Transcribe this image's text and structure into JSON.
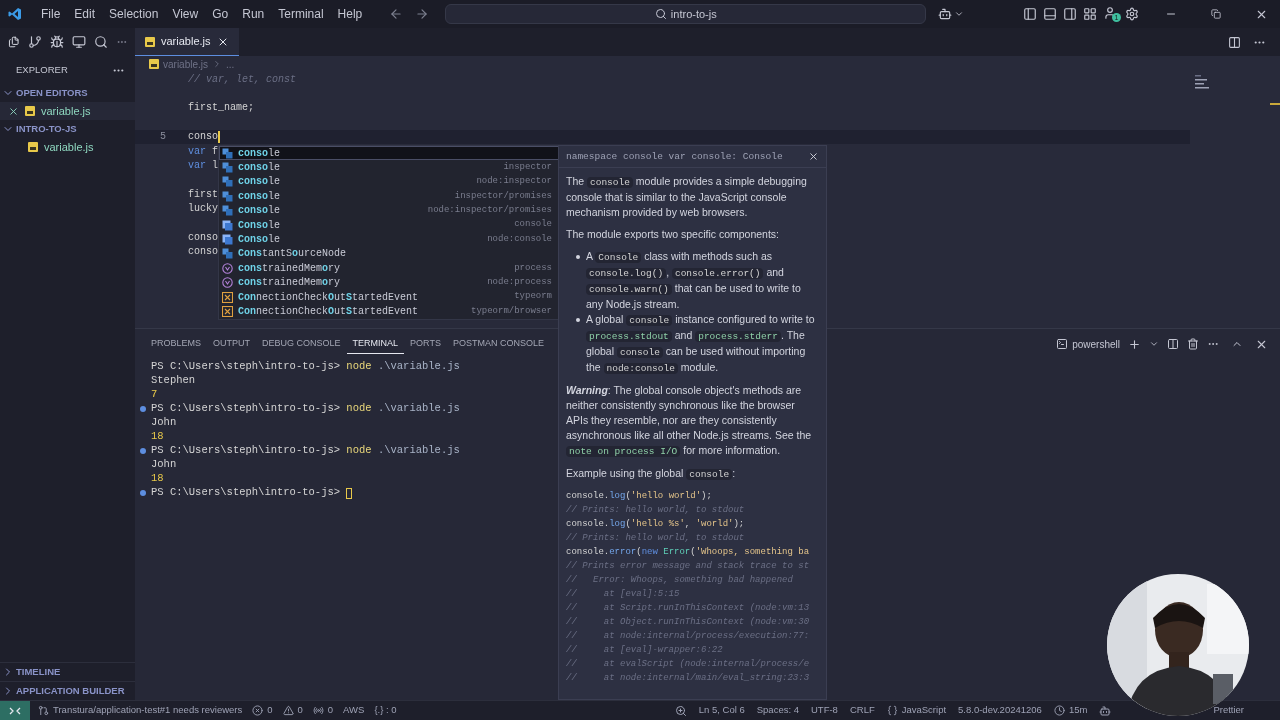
{
  "title_bar": {
    "menu": [
      "File",
      "Edit",
      "Selection",
      "View",
      "Go",
      "Run",
      "Terminal",
      "Help"
    ],
    "search": "intro-to-js",
    "account_badge": "1"
  },
  "sidebar": {
    "header": "EXPLORER",
    "sections": [
      {
        "title": "OPEN EDITORS",
        "expanded": true,
        "items": [
          {
            "name": "variable.js",
            "closable": true
          }
        ]
      },
      {
        "title": "INTRO-TO-JS",
        "expanded": true,
        "items": [
          {
            "name": "variable.js",
            "closable": false
          }
        ]
      }
    ],
    "bottom_sections": [
      {
        "title": "TIMELINE",
        "expanded": false
      },
      {
        "title": "APPLICATION BUILDER",
        "expanded": false
      }
    ]
  },
  "editor": {
    "tabs": [
      {
        "label": "variable.js",
        "selected": true
      }
    ],
    "breadcrumb": [
      "variable.js",
      "..."
    ],
    "lines": [
      {
        "kind": "code",
        "parts": [
          {
            "t": "// var, let, const",
            "kind": "com"
          }
        ]
      },
      {
        "kind": "blank"
      },
      {
        "kind": "code",
        "parts": [
          {
            "t": "first_name;",
            "kind": "id"
          }
        ]
      },
      {
        "kind": "blank"
      },
      {
        "kind": "code",
        "current": true,
        "number": "5",
        "parts": [
          {
            "t": "conso",
            "kind": "id"
          }
        ]
      },
      {
        "kind": "code",
        "parts": [
          {
            "t": "var",
            "kind": "kw"
          },
          {
            "t": " f",
            "kind": "id"
          }
        ]
      },
      {
        "kind": "code",
        "parts": [
          {
            "t": "var",
            "kind": "kw"
          },
          {
            "t": " l",
            "kind": "id"
          }
        ]
      },
      {
        "kind": "blank"
      },
      {
        "kind": "code",
        "parts": [
          {
            "t": "first",
            "kind": "id"
          }
        ]
      },
      {
        "kind": "code",
        "parts": [
          {
            "t": "lucky",
            "kind": "id"
          }
        ]
      },
      {
        "kind": "blank"
      },
      {
        "kind": "code",
        "parts": [
          {
            "t": "conso",
            "kind": "id"
          }
        ]
      },
      {
        "kind": "code",
        "parts": [
          {
            "t": "conso",
            "kind": "id"
          }
        ]
      }
    ],
    "suggestions": [
      {
        "kind": "module",
        "selected": true,
        "label": [
          {
            "t": "conso",
            "kind": "match"
          },
          {
            "t": "le",
            "kind": "rest"
          }
        ]
      },
      {
        "kind": "module",
        "selected": false,
        "detail": "inspector",
        "label": [
          {
            "t": "conso",
            "kind": "match"
          },
          {
            "t": "le",
            "kind": "rest"
          }
        ]
      },
      {
        "kind": "module",
        "selected": false,
        "detail": "node:inspector",
        "label": [
          {
            "t": "conso",
            "kind": "match"
          },
          {
            "t": "le",
            "kind": "rest"
          }
        ]
      },
      {
        "kind": "module",
        "selected": false,
        "detail": "inspector/promises",
        "label": [
          {
            "t": "conso",
            "kind": "match"
          },
          {
            "t": "le",
            "kind": "rest"
          }
        ]
      },
      {
        "kind": "module",
        "selected": false,
        "detail": "node:inspector/promises",
        "label": [
          {
            "t": "conso",
            "kind": "match"
          },
          {
            "t": "le",
            "kind": "rest"
          }
        ]
      },
      {
        "kind": "class",
        "selected": false,
        "detail": "console",
        "label": [
          {
            "t": "Conso",
            "kind": "match"
          },
          {
            "t": "le",
            "kind": "rest"
          }
        ]
      },
      {
        "kind": "class",
        "selected": false,
        "detail": "node:console",
        "label": [
          {
            "t": "Conso",
            "kind": "match"
          },
          {
            "t": "le",
            "kind": "rest"
          }
        ]
      },
      {
        "kind": "module",
        "selected": false,
        "label": [
          {
            "t": "Cons",
            "kind": "match"
          },
          {
            "t": "tantS",
            "kind": "rest"
          },
          {
            "t": "o",
            "kind": "match"
          },
          {
            "t": "urceNode",
            "kind": "rest"
          }
        ]
      },
      {
        "kind": "property",
        "selected": false,
        "detail": "process",
        "label": [
          {
            "t": "cons",
            "kind": "match"
          },
          {
            "t": "trainedMem",
            "kind": "rest"
          },
          {
            "t": "o",
            "kind": "match"
          },
          {
            "t": "ry",
            "kind": "rest"
          }
        ]
      },
      {
        "kind": "property",
        "selected": false,
        "detail": "node:process",
        "label": [
          {
            "t": "cons",
            "kind": "match"
          },
          {
            "t": "trainedMem",
            "kind": "rest"
          },
          {
            "t": "o",
            "kind": "match"
          },
          {
            "t": "ry",
            "kind": "rest"
          }
        ]
      },
      {
        "kind": "event",
        "selected": false,
        "detail": "typeorm",
        "label": [
          {
            "t": "Con",
            "kind": "match"
          },
          {
            "t": "nectionCheck",
            "kind": "rest"
          },
          {
            "t": "O",
            "kind": "match"
          },
          {
            "t": "ut",
            "kind": "rest"
          },
          {
            "t": "S",
            "kind": "match"
          },
          {
            "t": "tartedEvent",
            "kind": "rest"
          }
        ]
      },
      {
        "kind": "event",
        "selected": false,
        "detail": "typeorm/browser",
        "label": [
          {
            "t": "Con",
            "kind": "match"
          },
          {
            "t": "nectionCheck",
            "kind": "rest"
          },
          {
            "t": "O",
            "kind": "match"
          },
          {
            "t": "ut",
            "kind": "rest"
          },
          {
            "t": "S",
            "kind": "match"
          },
          {
            "t": "tartedEvent",
            "kind": "rest"
          }
        ]
      }
    ]
  },
  "hover": {
    "signature": "namespace console var console: Console",
    "blocks": [
      {
        "kind": "para",
        "parts": [
          {
            "t": "The ",
            "kind": "text"
          },
          {
            "t": "console",
            "kind": "code"
          },
          {
            "t": " module provides a simple debugging console that is similar to the JavaScript console mechanism provided by web browsers.",
            "kind": "text"
          }
        ]
      },
      {
        "kind": "para",
        "parts": [
          {
            "t": "The module exports two specific components:",
            "kind": "text"
          }
        ]
      },
      {
        "kind": "bullets",
        "items": [
          [
            {
              "t": "A ",
              "kind": "text"
            },
            {
              "t": "Console",
              "kind": "code"
            },
            {
              "t": " class with methods such as ",
              "kind": "text"
            },
            {
              "t": "console.log()",
              "kind": "code"
            },
            {
              "t": ", ",
              "kind": "text"
            },
            {
              "t": "console.error()",
              "kind": "code"
            },
            {
              "t": " and ",
              "kind": "text"
            },
            {
              "t": "console.warn()",
              "kind": "code"
            },
            {
              "t": " that can be used to write to any Node.js stream.",
              "kind": "text"
            }
          ],
          [
            {
              "t": "A global ",
              "kind": "text"
            },
            {
              "t": "console",
              "kind": "code"
            },
            {
              "t": " instance configured to write to ",
              "kind": "text"
            },
            {
              "t": "process.stdout",
              "kind": "path"
            },
            {
              "t": " and ",
              "kind": "text"
            },
            {
              "t": "process.stderr",
              "kind": "path"
            },
            {
              "t": ". The global ",
              "kind": "text"
            },
            {
              "t": "console",
              "kind": "code"
            },
            {
              "t": " can be used without importing the ",
              "kind": "text"
            },
            {
              "t": "node:console",
              "kind": "code"
            },
            {
              "t": " module.",
              "kind": "text"
            }
          ]
        ]
      },
      {
        "kind": "para",
        "parts": [
          {
            "t": "Warning",
            "kind": "em"
          },
          {
            "t": ": The global console object's methods are neither consistently synchronous like the browser APIs they resemble, nor are they consistently asynchronous like all other Node.js streams. See the ",
            "kind": "text"
          },
          {
            "t": "note on process I/O",
            "kind": "link"
          },
          {
            "t": " for more information.",
            "kind": "text"
          }
        ]
      },
      {
        "kind": "para",
        "parts": [
          {
            "t": "Example using the global ",
            "kind": "text"
          },
          {
            "t": "console",
            "kind": "code"
          },
          {
            "t": ":",
            "kind": "text"
          }
        ]
      },
      {
        "kind": "code",
        "lines": [
          [
            {
              "t": "console.",
              "kind": "id"
            },
            {
              "t": "log",
              "kind": "fn"
            },
            {
              "t": "(",
              "kind": "id"
            },
            {
              "t": "'hello world'",
              "kind": "str"
            },
            {
              "t": ");",
              "kind": "id"
            }
          ],
          [
            {
              "t": "// Prints: hello world, to stdout",
              "kind": "com"
            }
          ],
          [
            {
              "t": "console.",
              "kind": "id"
            },
            {
              "t": "log",
              "kind": "fn"
            },
            {
              "t": "(",
              "kind": "id"
            },
            {
              "t": "'hello %s'",
              "kind": "str"
            },
            {
              "t": ", ",
              "kind": "id"
            },
            {
              "t": "'world'",
              "kind": "str"
            },
            {
              "t": ");",
              "kind": "id"
            }
          ],
          [
            {
              "t": "// Prints: hello world, to stdout",
              "kind": "com"
            }
          ],
          [
            {
              "t": "console.",
              "kind": "id"
            },
            {
              "t": "error",
              "kind": "fn"
            },
            {
              "t": "(",
              "kind": "id"
            },
            {
              "t": "new ",
              "kind": "kw"
            },
            {
              "t": "Error",
              "kind": "cls"
            },
            {
              "t": "(",
              "kind": "id"
            },
            {
              "t": "'Whoops, something ba",
              "kind": "str"
            }
          ],
          [
            {
              "t": "// Prints error message and stack trace to st",
              "kind": "com"
            }
          ],
          [
            {
              "t": "//   Error: Whoops, something bad happened",
              "kind": "com"
            }
          ],
          [
            {
              "t": "//     at [eval]:5:15",
              "kind": "com"
            }
          ],
          [
            {
              "t": "//     at Script.runInThisContext (node:vm:13",
              "kind": "com"
            }
          ],
          [
            {
              "t": "//     at Object.runInThisContext (node:vm:30",
              "kind": "com"
            }
          ],
          [
            {
              "t": "//     at node:internal/process/execution:77:",
              "kind": "com"
            }
          ],
          [
            {
              "t": "//     at [eval]-wrapper:6:22",
              "kind": "com"
            }
          ],
          [
            {
              "t": "//     at evalScript (node:internal/process/e",
              "kind": "com"
            }
          ],
          [
            {
              "t": "//     at node:internal/main/eval_string:23:3",
              "kind": "com"
            }
          ]
        ]
      }
    ]
  },
  "panel": {
    "tabs": [
      {
        "label": "PROBLEMS",
        "selected": false
      },
      {
        "label": "OUTPUT",
        "selected": false
      },
      {
        "label": "DEBUG CONSOLE",
        "selected": false
      },
      {
        "label": "TERMINAL",
        "selected": true
      },
      {
        "label": "PORTS",
        "selected": false
      },
      {
        "label": "POSTMAN CONSOLE",
        "selected": false
      }
    ],
    "shell": "powershell",
    "terminal": [
      {
        "kind": "prompt",
        "decorated": false,
        "cursor": false,
        "path": "PS C:\\Users\\steph\\intro-to-js>",
        "command": "node",
        "arg": ".\\variable.js"
      },
      {
        "kind": "output",
        "text": "Stephen"
      },
      {
        "kind": "number",
        "text": "7"
      },
      {
        "kind": "prompt",
        "decorated": true,
        "cursor": false,
        "path": "PS C:\\Users\\steph\\intro-to-js>",
        "command": "node",
        "arg": ".\\variable.js"
      },
      {
        "kind": "output",
        "text": "John"
      },
      {
        "kind": "number",
        "text": "18"
      },
      {
        "kind": "prompt",
        "decorated": true,
        "cursor": false,
        "path": "PS C:\\Users\\steph\\intro-to-js>",
        "command": "node",
        "arg": ".\\variable.js"
      },
      {
        "kind": "output",
        "text": "John"
      },
      {
        "kind": "number",
        "text": "18"
      },
      {
        "kind": "prompt",
        "decorated": true,
        "cursor": true,
        "path": "PS C:\\Users\\steph\\intro-to-js>"
      }
    ]
  },
  "status_bar": {
    "left": [
      {
        "kind": "pr",
        "text": "Transtura/application-test#1 needs reviewers"
      },
      {
        "kind": "error",
        "text": "0"
      },
      {
        "kind": "warning",
        "text": "0"
      },
      {
        "kind": "ports",
        "text": "0"
      },
      {
        "kind": "plain",
        "text": "AWS"
      },
      {
        "kind": "plain",
        "text": "{.} : 0"
      }
    ],
    "right": [
      {
        "kind": "zoom"
      },
      {
        "kind": "plain",
        "text": "Ln 5, Col 6"
      },
      {
        "kind": "plain",
        "text": "Spaces: 4"
      },
      {
        "kind": "plain",
        "text": "UTF-8"
      },
      {
        "kind": "plain",
        "text": "CRLF"
      },
      {
        "kind": "braces",
        "text": "JavaScript"
      },
      {
        "kind": "plain",
        "text": "5.8.0-dev.20241206"
      },
      {
        "kind": "clock",
        "text": "15m"
      },
      {
        "kind": "copilot"
      },
      {
        "kind": "plain",
        "text": "Prettier"
      }
    ]
  }
}
